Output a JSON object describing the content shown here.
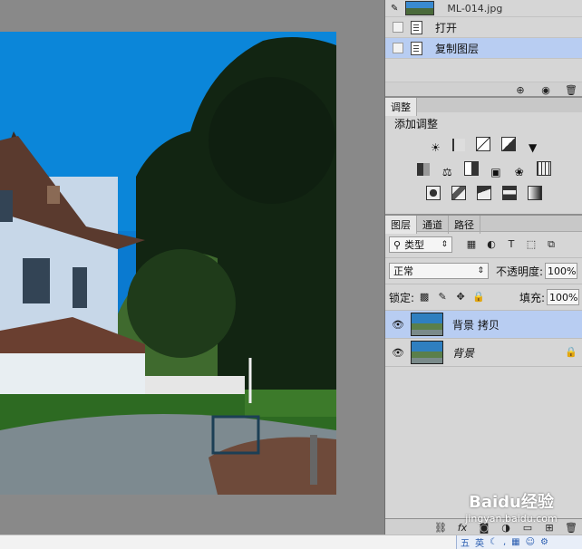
{
  "history": {
    "snapshot_label": "ML-014.jpg",
    "items": [
      {
        "label": "打开",
        "selected": false
      },
      {
        "label": "复制图层",
        "selected": true
      }
    ]
  },
  "adjustments": {
    "tab_label": "调整",
    "heading": "添加调整"
  },
  "layers_panel": {
    "tabs": [
      "图层",
      "通道",
      "路径"
    ],
    "filter_kind": "类型",
    "blend_mode": "正常",
    "opacity_label": "不透明度:",
    "opacity_value": "100%",
    "lock_label": "锁定:",
    "fill_label": "填充:",
    "fill_value": "100%",
    "layers": [
      {
        "name": "背景 拷贝",
        "selected": true
      },
      {
        "name": "背景",
        "selected": false
      }
    ]
  },
  "watermark": {
    "text": "Baidu经验",
    "url": "jingyan.baidu.com"
  },
  "colors": {
    "panel_bg": "#d6d6d6",
    "selection": "#b8cdf2",
    "canvas_bg": "#898989"
  }
}
